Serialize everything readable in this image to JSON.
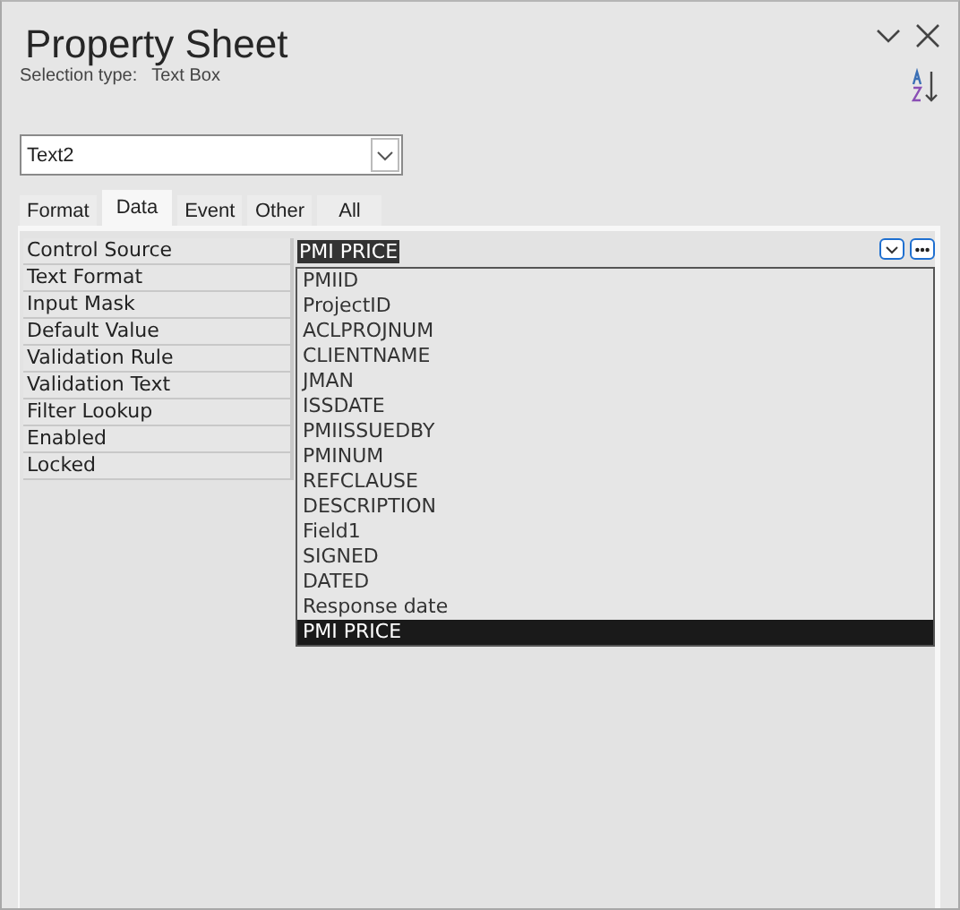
{
  "window": {
    "title": "Property Sheet"
  },
  "selection_type": {
    "label": "Selection type:",
    "value": "Text Box"
  },
  "object_selector": {
    "value": "Text2"
  },
  "tabs": [
    {
      "label": "Format",
      "selected": false
    },
    {
      "label": "Data",
      "selected": true
    },
    {
      "label": "Event",
      "selected": false
    },
    {
      "label": "Other",
      "selected": false
    },
    {
      "label": "All",
      "selected": false
    }
  ],
  "properties": [
    {
      "label": "Control Source",
      "value": "PMI PRICE",
      "focused": true
    },
    {
      "label": "Text Format"
    },
    {
      "label": "Input Mask"
    },
    {
      "label": "Default Value"
    },
    {
      "label": "Validation Rule"
    },
    {
      "label": "Validation Text"
    },
    {
      "label": "Filter Lookup"
    },
    {
      "label": "Enabled"
    },
    {
      "label": "Locked"
    }
  ],
  "dropdown": {
    "items": [
      {
        "label": "PMIID",
        "selected": false
      },
      {
        "label": "ProjectID",
        "selected": false
      },
      {
        "label": "ACLPROJNUM",
        "selected": false
      },
      {
        "label": "CLIENTNAME",
        "selected": false
      },
      {
        "label": "JMAN",
        "selected": false
      },
      {
        "label": "ISSDATE",
        "selected": false
      },
      {
        "label": "PMIISSUEDBY",
        "selected": false
      },
      {
        "label": "PMINUM",
        "selected": false
      },
      {
        "label": "REFCLAUSE",
        "selected": false
      },
      {
        "label": "DESCRIPTION",
        "selected": false
      },
      {
        "label": "Field1",
        "selected": false
      },
      {
        "label": "SIGNED",
        "selected": false
      },
      {
        "label": "DATED",
        "selected": false
      },
      {
        "label": "Response date",
        "selected": false
      },
      {
        "label": "PMI PRICE",
        "selected": true
      }
    ]
  }
}
